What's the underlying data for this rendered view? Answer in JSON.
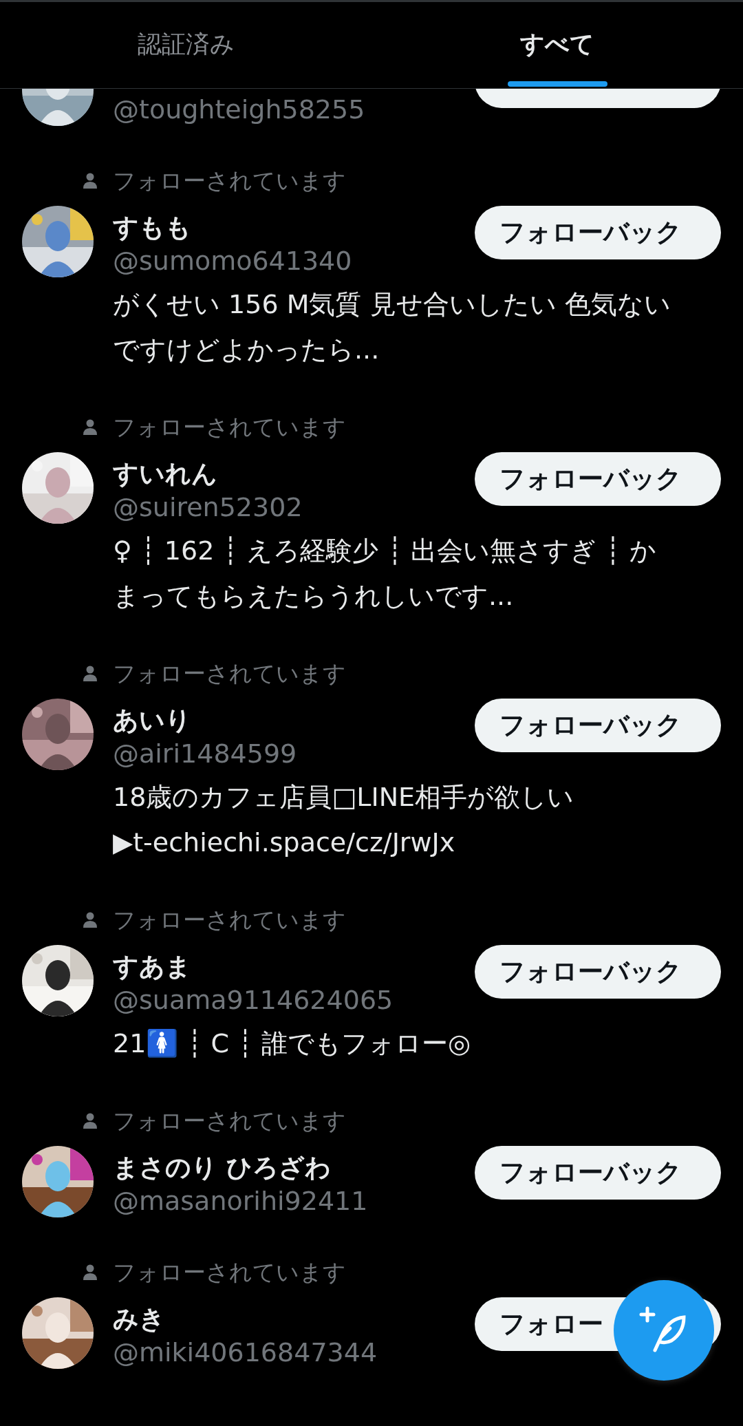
{
  "tabs": [
    {
      "label": "認証済み",
      "selected": false
    },
    {
      "label": "すべて",
      "selected": true
    }
  ],
  "users": [
    {
      "kind": "clipped",
      "handle": "@toughteigh58255"
    },
    {
      "kind": "full",
      "followed_label": "フォローされています",
      "name": "すもも",
      "handle": "@sumomo641340",
      "bio": "がくせい 156 M気質 見せ合いしたい 色気ないですけどよかったら...",
      "button": "フォローバック"
    },
    {
      "kind": "full",
      "followed_label": "フォローされています",
      "name": "すいれん",
      "handle": "@suiren52302",
      "bio": "♀ ┊ 162 ┊ えろ経験少 ┊ 出会い無さすぎ ┊ かまってもらえたらうれしいです...",
      "button": "フォローバック"
    },
    {
      "kind": "full",
      "followed_label": "フォローされています",
      "name": "あいり",
      "handle": "@airi1484599",
      "bio": "18歳のカフェ店員□LINE相手が欲しい\n▶t-echiechi.space/cz/JrwJx",
      "button": "フォローバック"
    },
    {
      "kind": "full",
      "followed_label": "フォローされています",
      "name": "すあま",
      "handle": "@suama9114624065",
      "bio": "21🚺 ┊ C ┊ 誰でもフォロー◎",
      "button": "フォローバック"
    },
    {
      "kind": "full",
      "followed_label": "フォローされています",
      "name": "まさのり ひろざわ",
      "handle": "@masanorihi92411",
      "button": "フォローバック"
    },
    {
      "kind": "full",
      "followed_label": "フォローされています",
      "name": "みき",
      "handle": "@miki40616847344",
      "button": "フォロー"
    }
  ]
}
